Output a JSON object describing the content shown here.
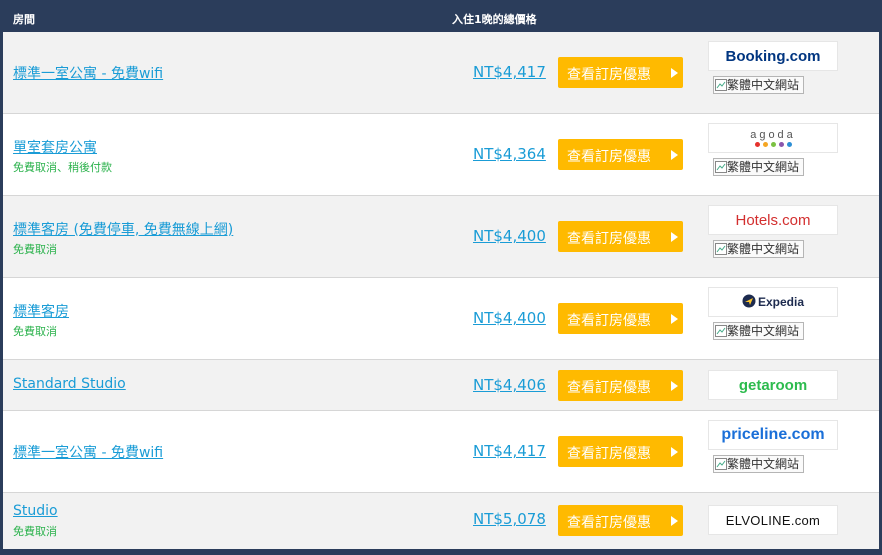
{
  "header": {
    "room_col": "房間",
    "price_col": "入住1晚的總價格"
  },
  "deal_button_label": "查看訂房優惠",
  "sub_link_label": "繁體中文網站",
  "rows": [
    {
      "room": "標準一室公寓 - 免費wifi",
      "sub": "",
      "price": "NT$4,417",
      "provider": "Booking.com",
      "provider_icon": "booking-logo",
      "has_sub_link": true
    },
    {
      "room": "單室套房公寓",
      "sub": "免費取消、稍後付款",
      "price": "NT$4,364",
      "provider": "agoda",
      "provider_icon": "agoda-logo",
      "has_sub_link": true
    },
    {
      "room": "標準客房 (免費停車, 免費無線上網)",
      "sub": "免費取消",
      "price": "NT$4,400",
      "provider": "Hotels.com",
      "provider_icon": "hotels-logo",
      "has_sub_link": true
    },
    {
      "room": "標準客房",
      "sub": "免費取消",
      "price": "NT$4,400",
      "provider": "Expedia",
      "provider_icon": "expedia-logo",
      "has_sub_link": true
    },
    {
      "room": "Standard Studio",
      "sub": "",
      "price": "NT$4,406",
      "provider": "getaroom",
      "provider_icon": "getaroom-logo",
      "has_sub_link": false
    },
    {
      "room": "標準一室公寓 - 免費wifi",
      "sub": "",
      "price": "NT$4,417",
      "provider": "priceline.com",
      "provider_icon": "priceline-logo",
      "has_sub_link": true
    },
    {
      "room": "Studio",
      "sub": "免費取消",
      "price": "NT$5,078",
      "provider": "ELVOLINE.com",
      "provider_icon": "elvoline-logo",
      "has_sub_link": false
    }
  ],
  "colors": {
    "header_bg": "#2b3d5b",
    "link": "#1a9cd6",
    "sub_green": "#2bb24c",
    "button": "#ffba00"
  }
}
